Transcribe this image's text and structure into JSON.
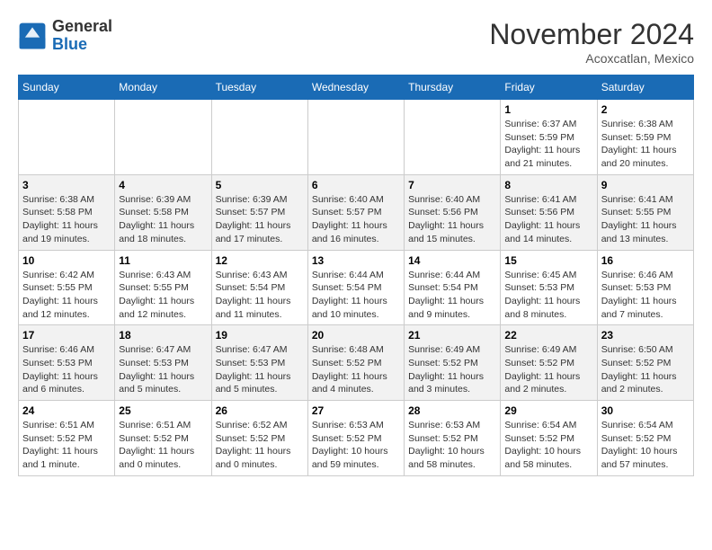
{
  "header": {
    "logo_general": "General",
    "logo_blue": "Blue",
    "month_title": "November 2024",
    "location": "Acoxcatlan, Mexico"
  },
  "weekdays": [
    "Sunday",
    "Monday",
    "Tuesday",
    "Wednesday",
    "Thursday",
    "Friday",
    "Saturday"
  ],
  "weeks": [
    [
      {
        "day": "",
        "info": ""
      },
      {
        "day": "",
        "info": ""
      },
      {
        "day": "",
        "info": ""
      },
      {
        "day": "",
        "info": ""
      },
      {
        "day": "",
        "info": ""
      },
      {
        "day": "1",
        "info": "Sunrise: 6:37 AM\nSunset: 5:59 PM\nDaylight: 11 hours\nand 21 minutes."
      },
      {
        "day": "2",
        "info": "Sunrise: 6:38 AM\nSunset: 5:59 PM\nDaylight: 11 hours\nand 20 minutes."
      }
    ],
    [
      {
        "day": "3",
        "info": "Sunrise: 6:38 AM\nSunset: 5:58 PM\nDaylight: 11 hours\nand 19 minutes."
      },
      {
        "day": "4",
        "info": "Sunrise: 6:39 AM\nSunset: 5:58 PM\nDaylight: 11 hours\nand 18 minutes."
      },
      {
        "day": "5",
        "info": "Sunrise: 6:39 AM\nSunset: 5:57 PM\nDaylight: 11 hours\nand 17 minutes."
      },
      {
        "day": "6",
        "info": "Sunrise: 6:40 AM\nSunset: 5:57 PM\nDaylight: 11 hours\nand 16 minutes."
      },
      {
        "day": "7",
        "info": "Sunrise: 6:40 AM\nSunset: 5:56 PM\nDaylight: 11 hours\nand 15 minutes."
      },
      {
        "day": "8",
        "info": "Sunrise: 6:41 AM\nSunset: 5:56 PM\nDaylight: 11 hours\nand 14 minutes."
      },
      {
        "day": "9",
        "info": "Sunrise: 6:41 AM\nSunset: 5:55 PM\nDaylight: 11 hours\nand 13 minutes."
      }
    ],
    [
      {
        "day": "10",
        "info": "Sunrise: 6:42 AM\nSunset: 5:55 PM\nDaylight: 11 hours\nand 12 minutes."
      },
      {
        "day": "11",
        "info": "Sunrise: 6:43 AM\nSunset: 5:55 PM\nDaylight: 11 hours\nand 12 minutes."
      },
      {
        "day": "12",
        "info": "Sunrise: 6:43 AM\nSunset: 5:54 PM\nDaylight: 11 hours\nand 11 minutes."
      },
      {
        "day": "13",
        "info": "Sunrise: 6:44 AM\nSunset: 5:54 PM\nDaylight: 11 hours\nand 10 minutes."
      },
      {
        "day": "14",
        "info": "Sunrise: 6:44 AM\nSunset: 5:54 PM\nDaylight: 11 hours\nand 9 minutes."
      },
      {
        "day": "15",
        "info": "Sunrise: 6:45 AM\nSunset: 5:53 PM\nDaylight: 11 hours\nand 8 minutes."
      },
      {
        "day": "16",
        "info": "Sunrise: 6:46 AM\nSunset: 5:53 PM\nDaylight: 11 hours\nand 7 minutes."
      }
    ],
    [
      {
        "day": "17",
        "info": "Sunrise: 6:46 AM\nSunset: 5:53 PM\nDaylight: 11 hours\nand 6 minutes."
      },
      {
        "day": "18",
        "info": "Sunrise: 6:47 AM\nSunset: 5:53 PM\nDaylight: 11 hours\nand 5 minutes."
      },
      {
        "day": "19",
        "info": "Sunrise: 6:47 AM\nSunset: 5:53 PM\nDaylight: 11 hours\nand 5 minutes."
      },
      {
        "day": "20",
        "info": "Sunrise: 6:48 AM\nSunset: 5:52 PM\nDaylight: 11 hours\nand 4 minutes."
      },
      {
        "day": "21",
        "info": "Sunrise: 6:49 AM\nSunset: 5:52 PM\nDaylight: 11 hours\nand 3 minutes."
      },
      {
        "day": "22",
        "info": "Sunrise: 6:49 AM\nSunset: 5:52 PM\nDaylight: 11 hours\nand 2 minutes."
      },
      {
        "day": "23",
        "info": "Sunrise: 6:50 AM\nSunset: 5:52 PM\nDaylight: 11 hours\nand 2 minutes."
      }
    ],
    [
      {
        "day": "24",
        "info": "Sunrise: 6:51 AM\nSunset: 5:52 PM\nDaylight: 11 hours\nand 1 minute."
      },
      {
        "day": "25",
        "info": "Sunrise: 6:51 AM\nSunset: 5:52 PM\nDaylight: 11 hours\nand 0 minutes."
      },
      {
        "day": "26",
        "info": "Sunrise: 6:52 AM\nSunset: 5:52 PM\nDaylight: 11 hours\nand 0 minutes."
      },
      {
        "day": "27",
        "info": "Sunrise: 6:53 AM\nSunset: 5:52 PM\nDaylight: 10 hours\nand 59 minutes."
      },
      {
        "day": "28",
        "info": "Sunrise: 6:53 AM\nSunset: 5:52 PM\nDaylight: 10 hours\nand 58 minutes."
      },
      {
        "day": "29",
        "info": "Sunrise: 6:54 AM\nSunset: 5:52 PM\nDaylight: 10 hours\nand 58 minutes."
      },
      {
        "day": "30",
        "info": "Sunrise: 6:54 AM\nSunset: 5:52 PM\nDaylight: 10 hours\nand 57 minutes."
      }
    ]
  ]
}
